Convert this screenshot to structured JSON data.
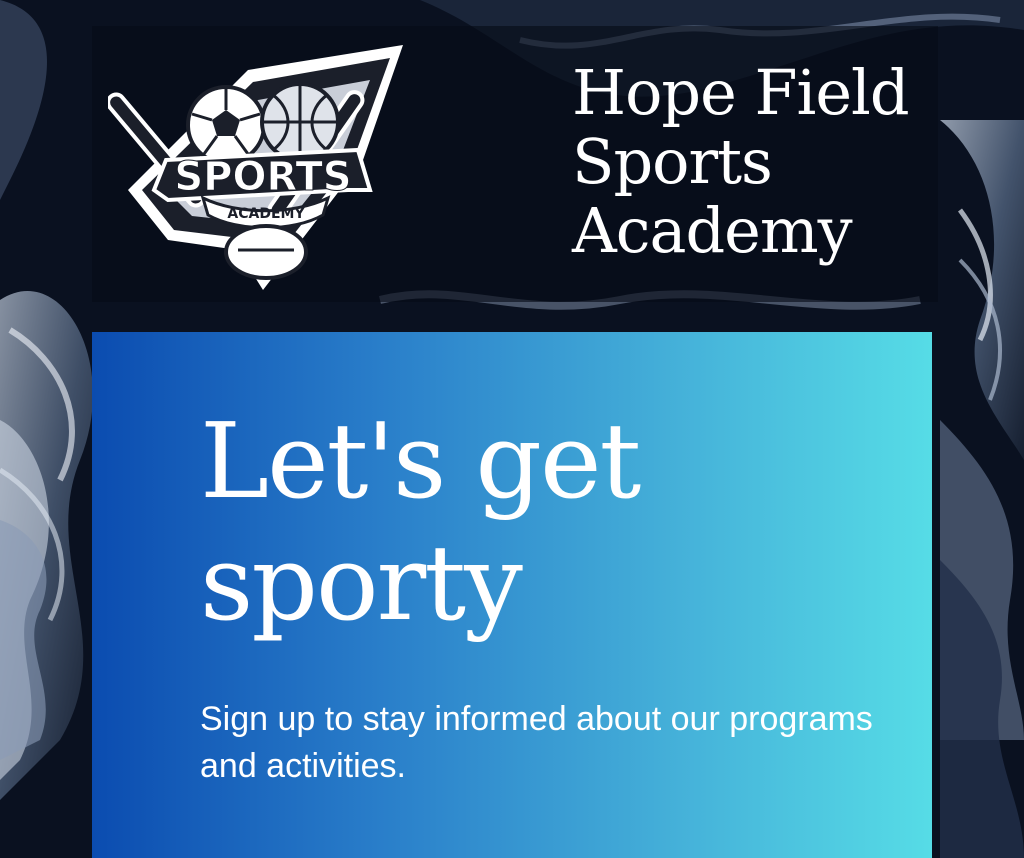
{
  "header": {
    "logo": {
      "icon": "sports-academy-badge",
      "wordmark": "SPORTS",
      "wordmark_sub": "ACADEMY"
    },
    "academy_name": "Hope Field Sports Academy"
  },
  "card": {
    "headline": "Let's get sporty",
    "subtext": "Sign up to stay informed about our programs and activities."
  },
  "colors": {
    "gradient_start": "#0b4cb0",
    "gradient_end": "#56dce6",
    "background_dark": "#0b1220",
    "text": "#ffffff"
  }
}
